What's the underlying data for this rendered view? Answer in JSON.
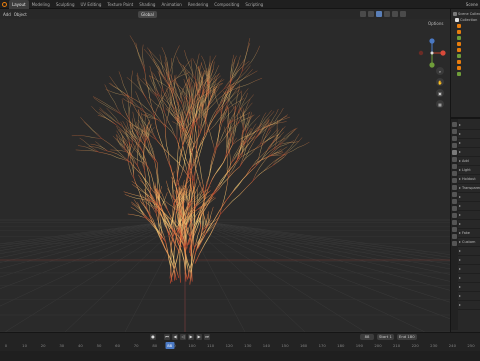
{
  "workspaces": [
    "Layout",
    "Modeling",
    "Sculpting",
    "UV Editing",
    "Texture Paint",
    "Shading",
    "Animation",
    "Rendering",
    "Compositing",
    "Scripting"
  ],
  "active_workspace": "Layout",
  "scene_label": "Scene",
  "viewport": {
    "menu": [
      "Add",
      "Object"
    ],
    "orientation": "Global",
    "options": "Options"
  },
  "outliner_rows": [
    "Scene Collection",
    "Collection",
    "",
    "",
    "",
    "",
    "",
    "",
    "",
    "",
    ""
  ],
  "properties_sections": [
    "",
    "",
    "",
    "",
    "Add",
    "Light",
    "Holdout",
    "Transparency",
    "",
    "",
    "",
    "",
    "Fake",
    "Custom",
    "",
    "",
    "",
    "",
    "",
    "",
    ""
  ],
  "timeline": {
    "frames": [
      0,
      10,
      20,
      30,
      40,
      50,
      60,
      70,
      80,
      90,
      100,
      110,
      120,
      130,
      140,
      150,
      160,
      170,
      180,
      190,
      200,
      210,
      220,
      230,
      240,
      250
    ],
    "current_frame": "88",
    "start_label": "Start",
    "start_value": "1",
    "end_label": "End",
    "end_value": "180"
  },
  "colors": {
    "accent_blue": "#4a79c4",
    "accent_orange": "#e87d0d",
    "wireframe_inner": "#f5d07a",
    "wireframe_outer": "#c2402a"
  }
}
